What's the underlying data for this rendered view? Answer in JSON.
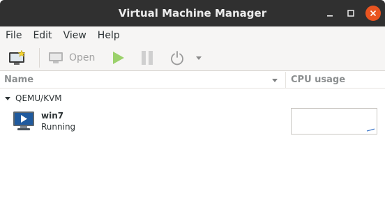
{
  "window": {
    "title": "Virtual Machine Manager"
  },
  "menubar": {
    "items": [
      "File",
      "Edit",
      "View",
      "Help"
    ]
  },
  "toolbar": {
    "open_label": "Open"
  },
  "columns": {
    "name_label": "Name",
    "cpu_label": "CPU usage"
  },
  "tree": {
    "group_label": "QEMU/KVM",
    "vm": {
      "name": "win7",
      "status": "Running",
      "cpu_usage_fraction": 0.08
    }
  },
  "colors": {
    "titlebar": "#303030",
    "close_button": "#e95420",
    "play_icon": "#8fce5a",
    "vm_icon_screen": "#1f5a9e",
    "cpu_line": "#3d77c9"
  },
  "icons": [
    "new-vm-icon",
    "monitor-icon",
    "play-icon",
    "pause-icon",
    "power-icon",
    "dropdown-arrow-icon",
    "vm-monitor-icon"
  ]
}
